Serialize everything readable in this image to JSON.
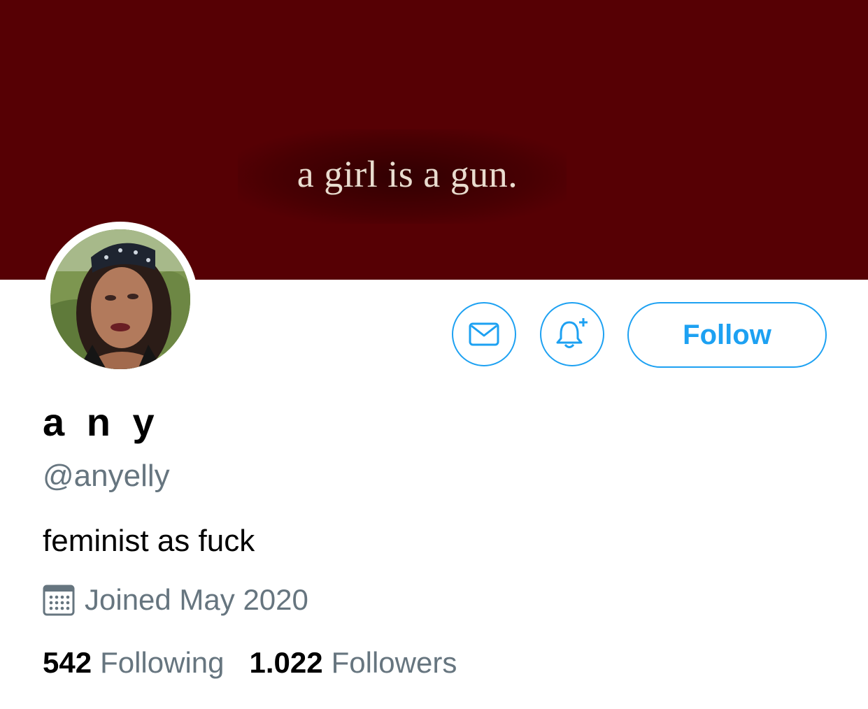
{
  "banner": {
    "text": "a girl is a gun.",
    "background_color": "#560004"
  },
  "actions": {
    "message_icon": "envelope-icon",
    "notify_icon": "bell-plus-icon",
    "follow_label": "Follow",
    "accent_color": "#1da1f2"
  },
  "profile": {
    "display_name": "a n y",
    "handle": "@anyelly",
    "bio": "feminist as fuck",
    "joined_icon": "calendar-icon",
    "joined": "Joined May 2020"
  },
  "stats": {
    "following_count": "542",
    "following_label": "Following",
    "followers_count": "1.022",
    "followers_label": "Followers"
  }
}
